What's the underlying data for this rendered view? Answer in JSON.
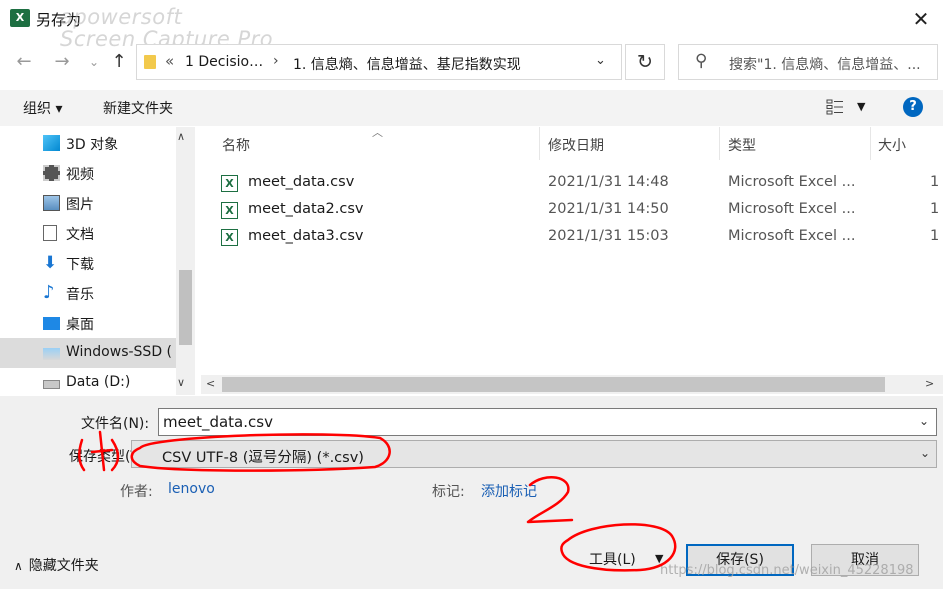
{
  "window": {
    "title": "另存为",
    "app_icon": "X",
    "watermark": "apowersoft\nScreen Capture Pro",
    "close": "✕"
  },
  "address": {
    "crumb1": "1 Decisio…",
    "sep": "›",
    "crumb2": "1. 信息熵、信息增益、基尼指数实现",
    "search_placeholder": "搜索\"1. 信息熵、信息增益、..."
  },
  "toolbar": {
    "organize": "组织 ▾",
    "new_folder": "新建文件夹",
    "help": "?"
  },
  "nav": [
    {
      "label": "3D 对象",
      "icon": "3d-objects-icon"
    },
    {
      "label": "视频",
      "icon": "video-icon"
    },
    {
      "label": "图片",
      "icon": "pictures-icon"
    },
    {
      "label": "文档",
      "icon": "documents-icon"
    },
    {
      "label": "下载",
      "icon": "download-icon"
    },
    {
      "label": "音乐",
      "icon": "music-icon"
    },
    {
      "label": "桌面",
      "icon": "desktop-icon"
    },
    {
      "label": "Windows-SSD (",
      "icon": "drive-icon"
    },
    {
      "label": "Data (D:)",
      "icon": "drive-icon"
    }
  ],
  "columns": {
    "name": "名称",
    "modified": "修改日期",
    "type": "类型",
    "size": "大小"
  },
  "files": [
    {
      "name": "meet_data.csv",
      "modified": "2021/1/31 14:48",
      "type": "Microsoft Excel ...",
      "size": "1"
    },
    {
      "name": "meet_data2.csv",
      "modified": "2021/1/31 14:50",
      "type": "Microsoft Excel ...",
      "size": "1"
    },
    {
      "name": "meet_data3.csv",
      "modified": "2021/1/31 15:03",
      "type": "Microsoft Excel ...",
      "size": "1"
    }
  ],
  "form": {
    "filename_label": "文件名(N):",
    "filename_value": "meet_data.csv",
    "filetype_label": "保存类型(T):",
    "filetype_value": "CSV UTF-8 (逗号分隔) (*.csv)",
    "author_label": "作者:",
    "author_value": "lenovo",
    "tags_label": "标记:",
    "tags_value": "添加标记"
  },
  "footer": {
    "hide_folders": "隐藏文件夹",
    "tools": "工具(L)",
    "save": "保存(S)",
    "cancel": "取消",
    "url_watermark": "https://blog.csdn.net/weixin_45228198"
  },
  "annotations": {
    "mark1": "1",
    "mark2": "2"
  },
  "colors": {
    "accent": "#0067c0",
    "excel_green": "#1d6f42",
    "annotation_red": "#ff0000",
    "link": "#1a5fb4"
  }
}
